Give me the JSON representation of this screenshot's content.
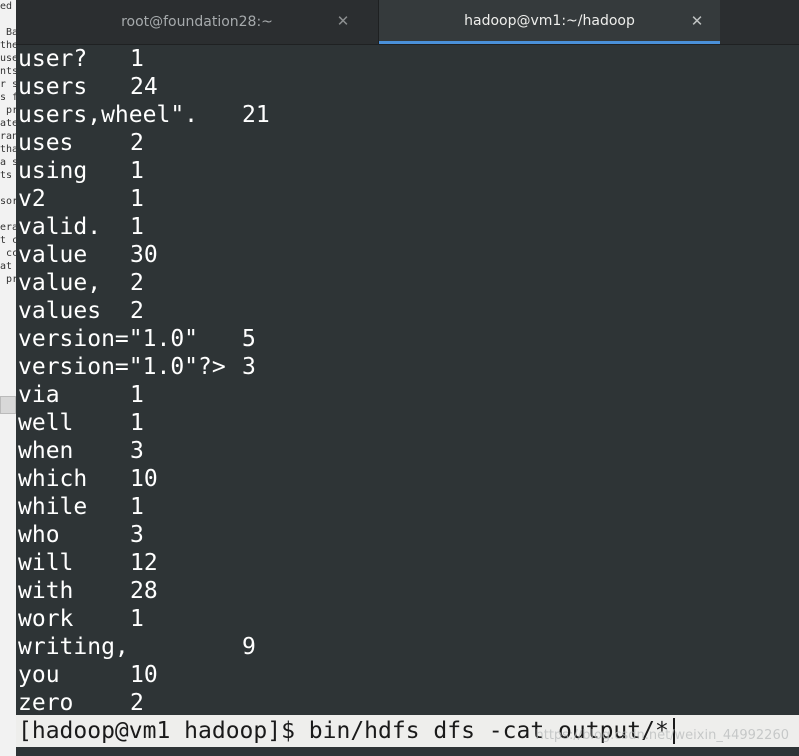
{
  "background_window": {
    "fragments": [
      "ed",
      "",
      " Ba",
      "the",
      "use",
      "nts",
      "r s",
      "s f",
      " pr",
      "ate",
      "ran",
      "tha",
      "a s",
      "ts",
      "",
      "sor",
      "",
      "era",
      "t c",
      " cc",
      "at",
      " pr"
    ]
  },
  "tabs": [
    {
      "title": "root@foundation28:~",
      "close": "✕"
    },
    {
      "title": "hadoop@vm1:~/hadoop",
      "close": "✕"
    }
  ],
  "output_lines": [
    {
      "word": "user?",
      "count": "1",
      "tabs": 1
    },
    {
      "word": "users",
      "count": "24",
      "tabs": 1
    },
    {
      "word": "users,wheel\".",
      "count": "21",
      "tabs": 2
    },
    {
      "word": "uses",
      "count": "2",
      "tabs": 1
    },
    {
      "word": "using",
      "count": "1",
      "tabs": 1
    },
    {
      "word": "v2",
      "count": "1",
      "tabs": 1
    },
    {
      "word": "valid.",
      "count": "1",
      "tabs": 1
    },
    {
      "word": "value",
      "count": "30",
      "tabs": 1
    },
    {
      "word": "value,",
      "count": "2",
      "tabs": 1
    },
    {
      "word": "values",
      "count": "2",
      "tabs": 1
    },
    {
      "word": "version=\"1.0\"",
      "count": "5",
      "tabs": 2
    },
    {
      "word": "version=\"1.0\"?>",
      "count": "3",
      "tabs": 2
    },
    {
      "word": "via",
      "count": "1",
      "tabs": 1
    },
    {
      "word": "well",
      "count": "1",
      "tabs": 1
    },
    {
      "word": "when",
      "count": "3",
      "tabs": 1
    },
    {
      "word": "which",
      "count": "10",
      "tabs": 1
    },
    {
      "word": "while",
      "count": "1",
      "tabs": 1
    },
    {
      "word": "who",
      "count": "3",
      "tabs": 1
    },
    {
      "word": "will",
      "count": "12",
      "tabs": 1
    },
    {
      "word": "with",
      "count": "28",
      "tabs": 1
    },
    {
      "word": "work",
      "count": "1",
      "tabs": 1
    },
    {
      "word": "writing,",
      "count": "9",
      "tabs": 2
    },
    {
      "word": "you",
      "count": "10",
      "tabs": 1
    },
    {
      "word": "zero",
      "count": "2",
      "tabs": 1
    }
  ],
  "prompt": {
    "text": "[hadoop@vm1 hadoop]$ bin/hdfs dfs -cat output/*"
  },
  "watermark": "https://blog.csdn.net/weixin_44992260",
  "colors": {
    "terminal_bg": "#2e3436",
    "terminal_fg": "#ffffff",
    "active_tab_indicator": "#4a90d9",
    "prompt_bg": "#eeeeec"
  }
}
